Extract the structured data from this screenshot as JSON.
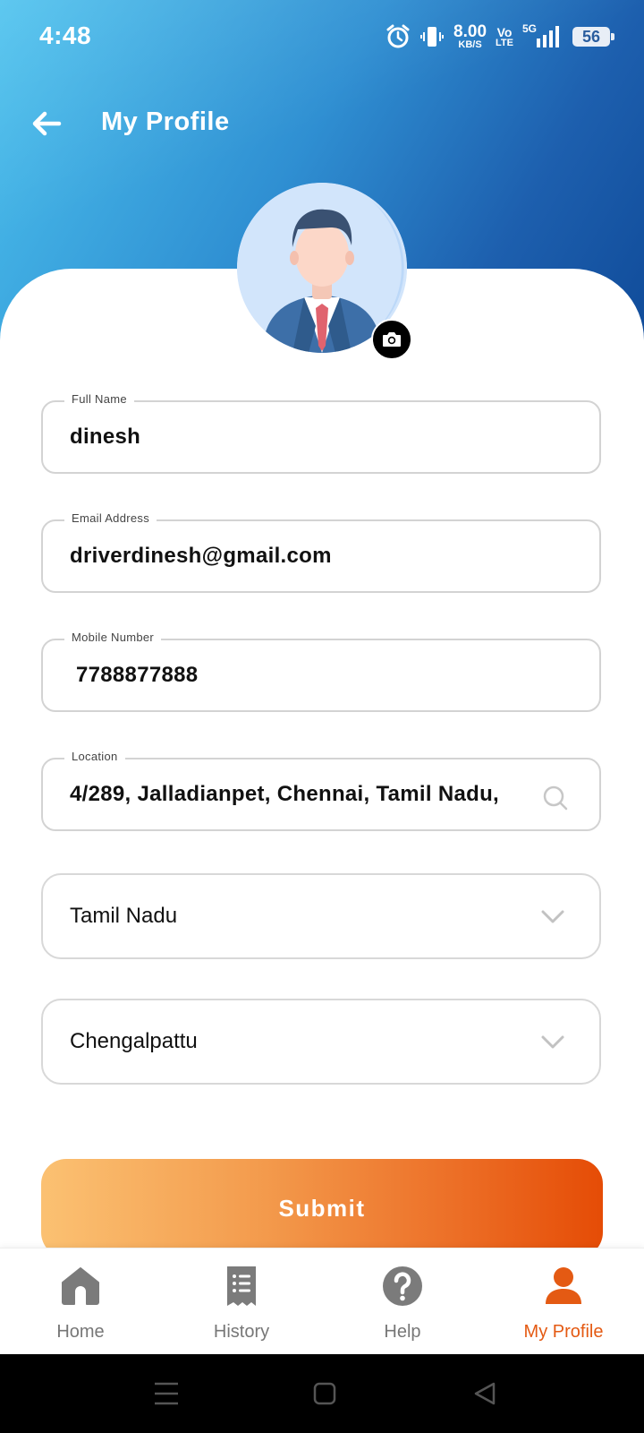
{
  "status_bar": {
    "time": "4:48",
    "net_speed_value": "8.00",
    "net_speed_unit": "KB/S",
    "volte_top": "Vo",
    "volte_bottom": "LTE",
    "network": "5G",
    "battery": "56"
  },
  "header": {
    "title": "My Profile",
    "back_icon": "arrow-left-icon"
  },
  "avatar": {
    "camera_icon": "camera-icon"
  },
  "form": {
    "full_name": {
      "label": "Full Name",
      "value": "dinesh"
    },
    "email": {
      "label": "Email Address",
      "value": "driverdinesh@gmail.com"
    },
    "mobile": {
      "label": "Mobile Number",
      "value": " 7788877888"
    },
    "location": {
      "label": "Location",
      "value": "4/289, Jalladianpet, Chennai, Tamil Nadu,",
      "icon": "search-icon"
    },
    "state": {
      "value": "Tamil Nadu",
      "icon": "chevron-down-icon"
    },
    "district": {
      "value": "Chengalpattu",
      "icon": "chevron-down-icon"
    },
    "submit_label": "Submit"
  },
  "bottom_nav": {
    "items": [
      {
        "label": "Home",
        "icon": "home-icon",
        "active": false
      },
      {
        "label": "History",
        "icon": "receipt-icon",
        "active": false
      },
      {
        "label": "Help",
        "icon": "help-icon",
        "active": false
      },
      {
        "label": "My Profile",
        "icon": "user-icon",
        "active": true
      }
    ]
  },
  "colors": {
    "accent": "#e45a13",
    "header_start": "#4cc2ee",
    "header_end": "#0f4a98"
  }
}
